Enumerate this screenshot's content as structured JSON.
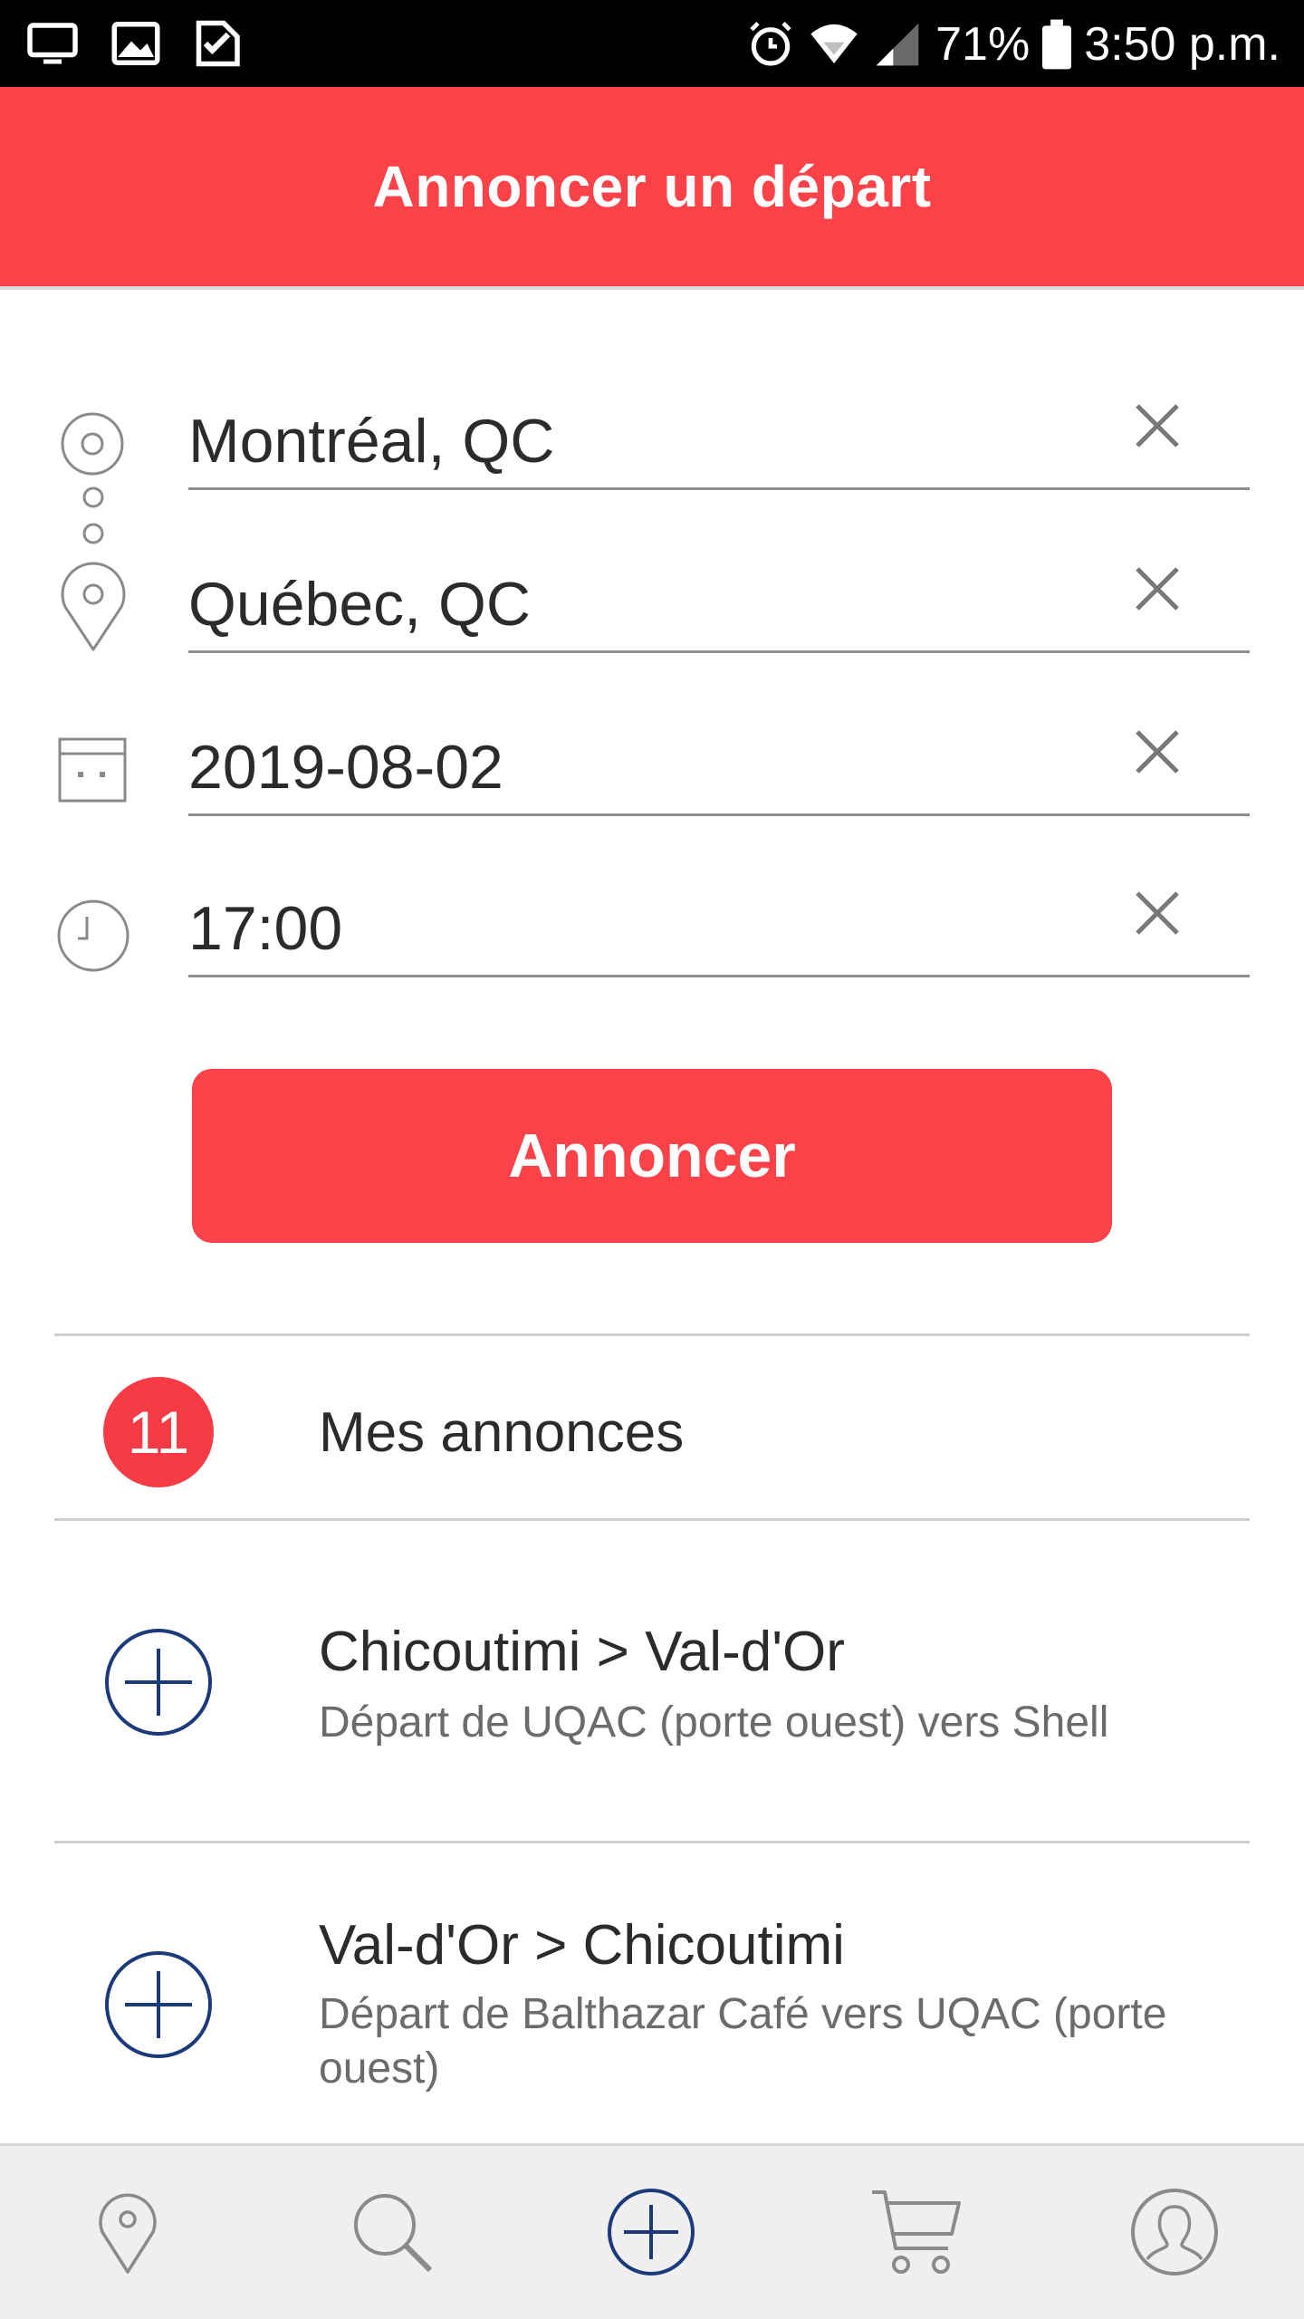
{
  "status_bar": {
    "battery": "71%",
    "time": "3:50 p.m.",
    "icons": [
      "monitor-icon",
      "image-icon",
      "checklist-icon",
      "alarm-icon",
      "wifi-icon",
      "signal-icon",
      "battery-icon"
    ]
  },
  "header": {
    "title": "Annoncer un départ"
  },
  "form": {
    "origin": "Montréal, QC",
    "destination": "Québec, QC",
    "date": "2019-08-02",
    "time": "17:00",
    "submit_label": "Annoncer"
  },
  "mes_annonces": {
    "count": "11",
    "label": "Mes annonces"
  },
  "trips": [
    {
      "title": "Chicoutimi > Val-d'Or",
      "subtitle": "Départ de UQAC (porte ouest) vers Shell"
    },
    {
      "title": "Val-d'Or > Chicoutimi",
      "subtitle": "Départ de Balthazar Café vers UQAC (porte ouest)"
    }
  ],
  "colors": {
    "accent": "#fc4249",
    "navy": "#1a3a7a"
  },
  "bottom_nav": [
    "map-pin-icon",
    "search-icon",
    "add-circle-icon",
    "cart-icon",
    "profile-icon"
  ]
}
